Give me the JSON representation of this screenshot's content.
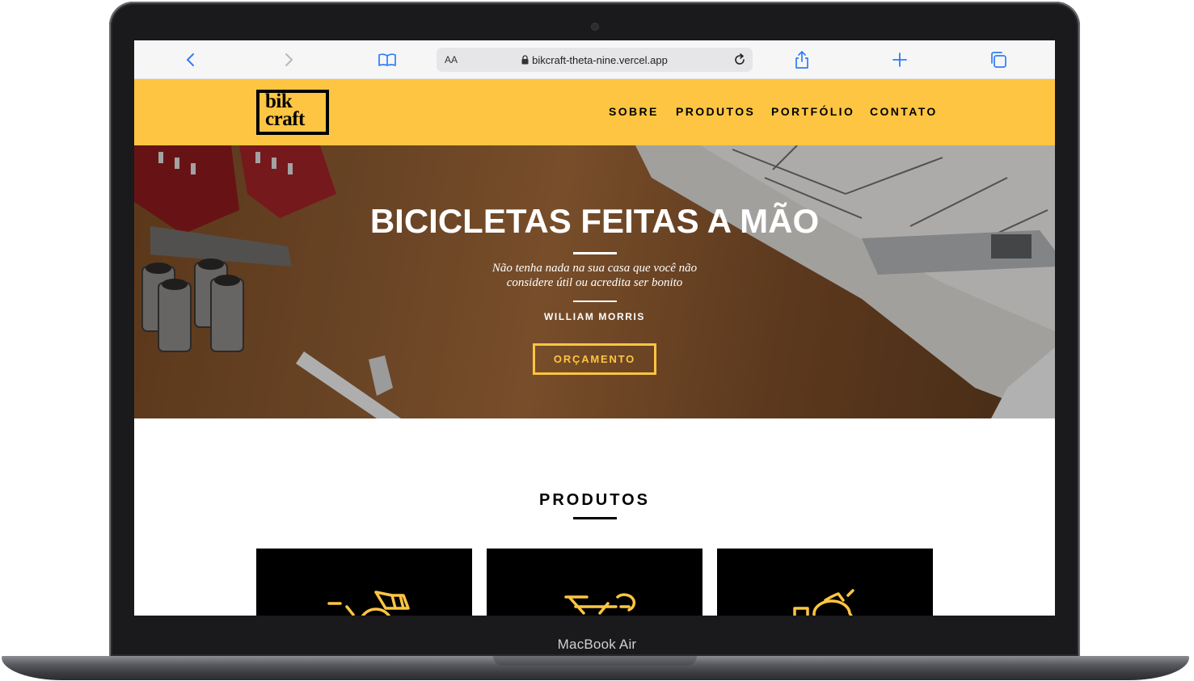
{
  "device": {
    "label": "MacBook Air"
  },
  "browser": {
    "url": "bikcraft-theta-nine.vercel.app",
    "reader_label": "AA",
    "icons": [
      "back-icon",
      "forward-icon",
      "bookmarks-icon",
      "lock-icon",
      "reload-icon",
      "share-icon",
      "new-tab-icon",
      "tabs-icon"
    ]
  },
  "site": {
    "logo": {
      "line1": "bik",
      "line2": "craft"
    },
    "nav": [
      {
        "label": "SOBRE"
      },
      {
        "label": "PRODUTOS"
      },
      {
        "label": "PORTFÓLIO"
      },
      {
        "label": "CONTATO"
      }
    ],
    "hero": {
      "title": "BICICLETAS FEITAS A MÃO",
      "quote_line1": "Não tenha nada na sua casa que você não",
      "quote_line2": "considere útil ou acredita ser bonito",
      "author": "WILLIAM MORRIS",
      "button": "ORÇAMENTO"
    },
    "products": {
      "title": "PRODUTOS",
      "cards": [
        {
          "icon": "cargo-bike-icon"
        },
        {
          "icon": "tandem-bike-icon"
        },
        {
          "icon": "scooter-icon"
        }
      ]
    }
  },
  "colors": {
    "brand_yellow": "#fec542",
    "black": "#000000",
    "white": "#ffffff"
  }
}
